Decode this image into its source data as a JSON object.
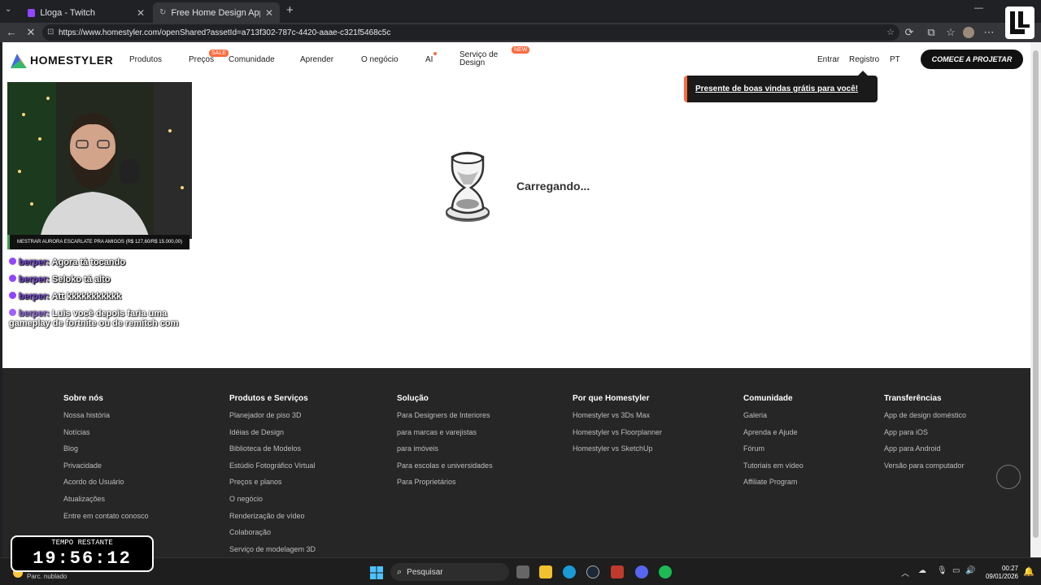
{
  "browser": {
    "tabs": [
      {
        "label": "Lloga - Twitch",
        "active": false
      },
      {
        "label": "Free Home Design App for Interior",
        "active": true
      }
    ],
    "url": "https://www.homestyler.com/openShared?assetId=a713f302-787c-4420-aaae-c321f5468c5c"
  },
  "nav": {
    "logo": "HOMESTYLER",
    "items": [
      "Produtos",
      "Preços",
      "Comunidade",
      "Aprender",
      "O negócio",
      "AI",
      "Serviço de Design"
    ],
    "sale_badge": "SALE",
    "new_badge": "NEW",
    "login": "Entrar",
    "register": "Registro",
    "lang": "PT",
    "cta": "COMECE A PROJETAR"
  },
  "tooltip": "Presente de boas vindas grátis para você!",
  "loading": "Carregando...",
  "stream": {
    "caption": "MESTRAR AURORA ESCARLATE PRA AMIGOS (R$ 127,60/R$ 15.000,00)",
    "chat": [
      {
        "user": "berper:",
        "msg": "Agora tá tocando"
      },
      {
        "user": "berper:",
        "msg": "Seloko tá alto"
      },
      {
        "user": "berper:",
        "msg": "Att kkkkkkkkkkk"
      },
      {
        "user": "berper:",
        "msg": "Luis você depois faria uma gameplay de fortnite ou de remitch com"
      }
    ],
    "timer_label": "TEMPO RESTANTE",
    "timer_value": "19:56:12"
  },
  "footer": {
    "columns": [
      {
        "title": "Sobre nós",
        "links": [
          "Nossa história",
          "Notícias",
          "Blog",
          "Privacidade",
          "Acordo do Usuário",
          "Atualizações",
          "Entre em contato conosco"
        ]
      },
      {
        "title": "Produtos e Serviços",
        "links": [
          "Planejador de piso 3D",
          "Idéias de Design",
          "Biblioteca de Modelos",
          "Estúdio Fotográfico Virtual",
          "Preços e planos",
          "O negócio",
          "Renderização de vídeo",
          "Colaboração",
          "Serviço de modelagem 3D"
        ]
      },
      {
        "title": "Solução",
        "links": [
          "Para Designers de Interiores",
          "para marcas e varejistas",
          "para imóveis",
          "Para escolas e universidades",
          "Para Proprietários"
        ]
      },
      {
        "title": "Por que Homestyler",
        "links": [
          "Homestyler vs 3Ds Max",
          "Homestyler vs Floorplanner",
          "Homestyler vs SketchUp"
        ]
      },
      {
        "title": "Comunidade",
        "links": [
          "Galeria",
          "Aprenda e Ajude",
          "Fórum",
          "Tutoriais em vídeo",
          "Affiliate Program"
        ]
      },
      {
        "title": "Transferências",
        "links": [
          "App de design doméstico",
          "App para iOS",
          "App para Android",
          "Versão para computador"
        ]
      }
    ]
  },
  "taskbar": {
    "search": "Pesquisar",
    "weather": "Parc. nublado",
    "time": "00:27",
    "date": "09/01/2026"
  }
}
